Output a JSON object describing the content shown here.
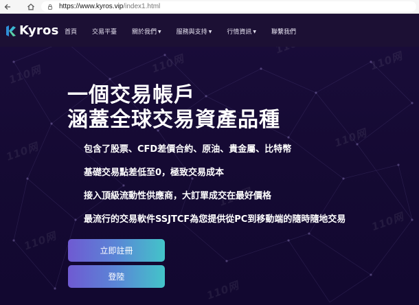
{
  "browser": {
    "url_host": "https://www.kyros.vip",
    "url_path": "/index1.html"
  },
  "brand": {
    "name": "Kyros"
  },
  "nav": {
    "items": [
      {
        "label": "首頁",
        "dropdown": false
      },
      {
        "label": "交易平臺",
        "dropdown": false
      },
      {
        "label": "關於我們",
        "dropdown": true
      },
      {
        "label": "服務與支持",
        "dropdown": true
      },
      {
        "label": "行情資訊",
        "dropdown": true
      },
      {
        "label": "聯繫我們",
        "dropdown": false
      }
    ]
  },
  "hero": {
    "headline_line1": "一個交易帳戶",
    "headline_line2": "涵蓋全球交易資產品種",
    "features": [
      "包含了股票、CFD差價合約、原油、貴金屬、比特幣",
      "基礎交易點差低至0，極致交易成本",
      "接入頂級流動性供應商，大訂單成交在最好價格",
      "最流行的交易軟件SSJTCF為您提供從PC到移動端的隨時隨地交易"
    ],
    "register_label": "立即註冊",
    "login_label": "登陸"
  },
  "watermark_text": "110网",
  "colors": {
    "background": "#170a34",
    "navbar": "#1c1034",
    "button_gradient_start": "#6f5ad2",
    "button_gradient_end": "#43c4c9"
  }
}
